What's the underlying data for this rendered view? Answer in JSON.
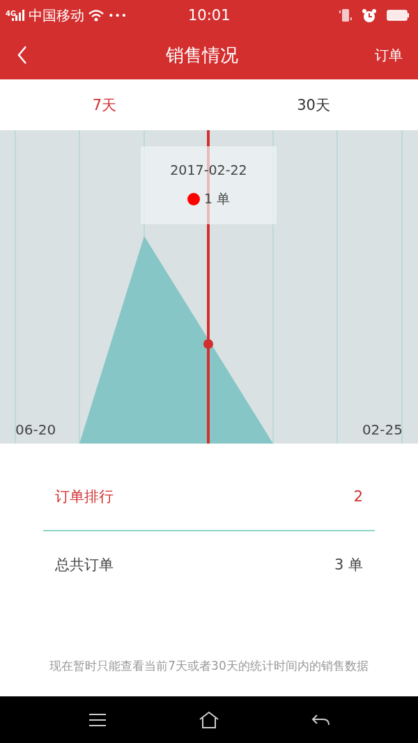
{
  "status_bar": {
    "network": "4G",
    "carrier": "中国移动",
    "more": "•••",
    "time": "10:01"
  },
  "header": {
    "title": "销售情况",
    "action": "订单"
  },
  "tabs": [
    {
      "label": "7天",
      "selected": true
    },
    {
      "label": "30天",
      "selected": false
    }
  ],
  "chart": {
    "start_label": "06-20",
    "end_label": "02-25",
    "tooltip": {
      "date": "2017-02-22",
      "value": "1 单",
      "color": "#ff0000"
    }
  },
  "rows": [
    {
      "label": "订单排行",
      "value": "2",
      "highlight": true
    },
    {
      "label": "总共订单",
      "value": "3 单",
      "highlight": false
    }
  ],
  "note": "现在暂时只能查看当前7天或者30天的统计时间内的销售数据"
}
